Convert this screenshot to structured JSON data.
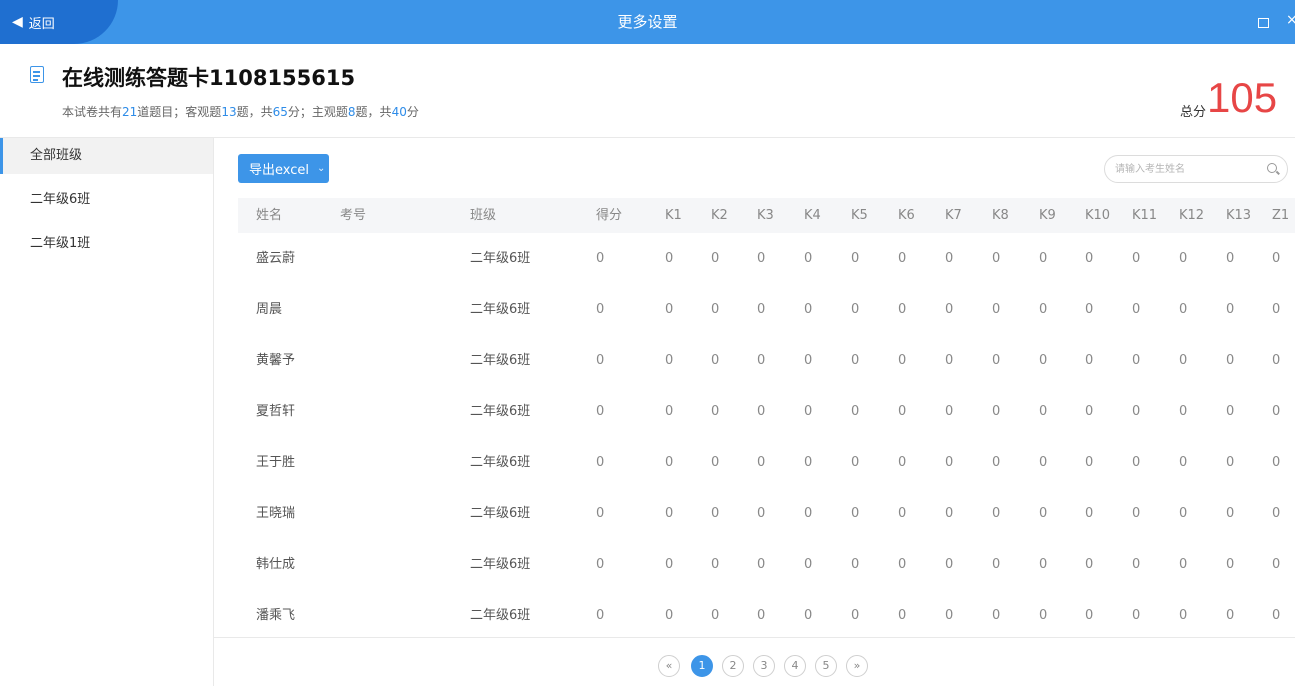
{
  "window": {
    "back_label": "返回",
    "title": "更多设置",
    "maximize_symbol": "□",
    "close_symbol": "×"
  },
  "header": {
    "title": "在线测练答题卡1108155615",
    "summary": {
      "p1": "本试卷共有",
      "total_questions": "21",
      "p2": "道题目；客观题",
      "objective_count": "13",
      "p3": "题，共",
      "objective_score": "65",
      "p4": "分；主观题",
      "subjective_count": "8",
      "p5": "题，共",
      "subjective_score": "40",
      "p6": "分"
    },
    "total_label": "总分",
    "total_value": "105"
  },
  "sidebar": {
    "items": [
      {
        "label": "全部班级",
        "active": true
      },
      {
        "label": "二年级6班",
        "active": false
      },
      {
        "label": "二年级1班",
        "active": false
      }
    ]
  },
  "toolbar": {
    "export_label": "导出excel",
    "export_chevron": "⌄",
    "search_placeholder": "请输入考生姓名",
    "search_icon": "search-icon"
  },
  "table": {
    "columns": [
      "姓名",
      "考号",
      "班级",
      "得分",
      "K1",
      "K2",
      "K3",
      "K4",
      "K5",
      "K6",
      "K7",
      "K8",
      "K9",
      "K10",
      "K11",
      "K12",
      "K13",
      "Z1"
    ],
    "rows": [
      [
        "盛云蔚",
        "",
        "二年级6班",
        "0",
        "0",
        "0",
        "0",
        "0",
        "0",
        "0",
        "0",
        "0",
        "0",
        "0",
        "0",
        "0",
        "0",
        "0"
      ],
      [
        "周晨",
        "",
        "二年级6班",
        "0",
        "0",
        "0",
        "0",
        "0",
        "0",
        "0",
        "0",
        "0",
        "0",
        "0",
        "0",
        "0",
        "0",
        "0"
      ],
      [
        "黄馨予",
        "",
        "二年级6班",
        "0",
        "0",
        "0",
        "0",
        "0",
        "0",
        "0",
        "0",
        "0",
        "0",
        "0",
        "0",
        "0",
        "0",
        "0"
      ],
      [
        "夏哲轩",
        "",
        "二年级6班",
        "0",
        "0",
        "0",
        "0",
        "0",
        "0",
        "0",
        "0",
        "0",
        "0",
        "0",
        "0",
        "0",
        "0",
        "0"
      ],
      [
        "王于胜",
        "",
        "二年级6班",
        "0",
        "0",
        "0",
        "0",
        "0",
        "0",
        "0",
        "0",
        "0",
        "0",
        "0",
        "0",
        "0",
        "0",
        "0"
      ],
      [
        "王晓瑞",
        "",
        "二年级6班",
        "0",
        "0",
        "0",
        "0",
        "0",
        "0",
        "0",
        "0",
        "0",
        "0",
        "0",
        "0",
        "0",
        "0",
        "0"
      ],
      [
        "韩仕成",
        "",
        "二年级6班",
        "0",
        "0",
        "0",
        "0",
        "0",
        "0",
        "0",
        "0",
        "0",
        "0",
        "0",
        "0",
        "0",
        "0",
        "0"
      ],
      [
        "潘乘飞",
        "",
        "二年级6班",
        "0",
        "0",
        "0",
        "0",
        "0",
        "0",
        "0",
        "0",
        "0",
        "0",
        "0",
        "0",
        "0",
        "0",
        "0"
      ]
    ]
  },
  "pagination": {
    "prev": "«",
    "pages": [
      "1",
      "2",
      "3",
      "4",
      "5"
    ],
    "current": "1",
    "next": "»"
  },
  "colors": {
    "accent": "#3d95e8",
    "total_score": "#e74646"
  }
}
